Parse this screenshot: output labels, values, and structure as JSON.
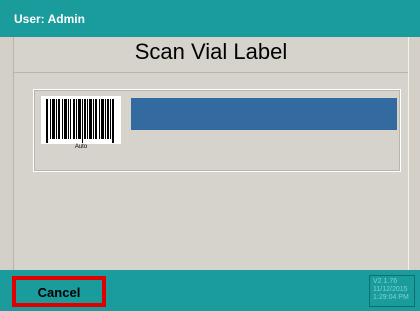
{
  "header": {
    "user_label": "User: Admin"
  },
  "main": {
    "title": "Scan Vial Label",
    "barcode_caption": "Auto",
    "scan_field_value": ""
  },
  "footer": {
    "cancel_label": "Cancel",
    "version": "V2.1.76",
    "date": "11/12/2015",
    "time": "1:29:04 PM"
  },
  "colors": {
    "header_bg": "#1a9b9c",
    "scan_field": "#336aa0",
    "highlight_border": "#e00000"
  },
  "icons": [
    "barcode-icon"
  ]
}
